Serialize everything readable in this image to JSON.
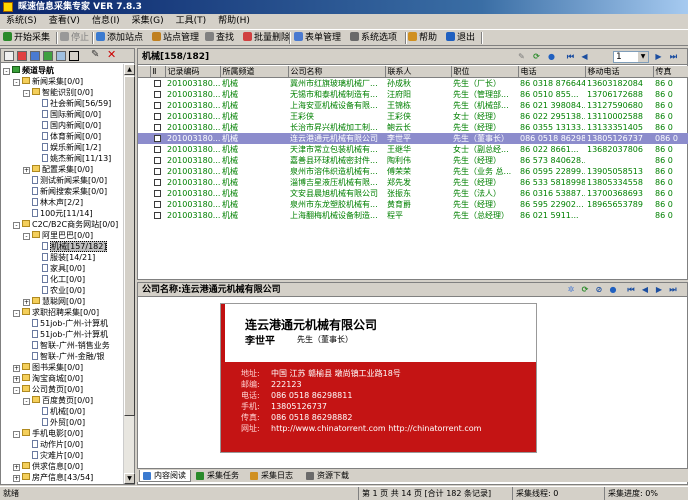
{
  "window": {
    "title": "睬速信息采集专家 VER 7.8.3"
  },
  "menu": [
    "系统(S)",
    "查看(V)",
    "信息(I)",
    "采集(G)",
    "工具(T)",
    "帮助(H)"
  ],
  "toolbar": [
    {
      "label": "开始采集",
      "enabled": true
    },
    {
      "label": "停止",
      "enabled": false
    },
    {
      "label": "添加站点",
      "enabled": true
    },
    {
      "label": "站点管理",
      "enabled": true
    },
    {
      "label": "查找",
      "enabled": true
    },
    {
      "label": "批量删除",
      "enabled": true
    },
    {
      "label": "表单管理",
      "enabled": true
    },
    {
      "label": "系统选项",
      "enabled": true
    },
    {
      "label": "帮助",
      "enabled": true
    },
    {
      "label": "退出",
      "enabled": true
    }
  ],
  "tree": [
    {
      "label": "频道导航",
      "level": 0,
      "type": "root",
      "exp": "-"
    },
    {
      "label": "新闻采集[0/0]",
      "level": 1,
      "type": "folder",
      "exp": "-"
    },
    {
      "label": "智能识别[0/0]",
      "level": 2,
      "type": "folder",
      "exp": "-"
    },
    {
      "label": "社会新闻[56/59]",
      "level": 3,
      "type": "doc"
    },
    {
      "label": "国际新闻[0/0]",
      "level": 3,
      "type": "doc"
    },
    {
      "label": "国内新闻[0/0]",
      "level": 3,
      "type": "doc"
    },
    {
      "label": "体育新闻[0/0]",
      "level": 3,
      "type": "doc"
    },
    {
      "label": "娱乐新闻[1/2]",
      "level": 3,
      "type": "doc"
    },
    {
      "label": "姚杰新闻[11/13]",
      "level": 3,
      "type": "doc"
    },
    {
      "label": "配置采集[0/0]",
      "level": 2,
      "type": "folder",
      "exp": "+"
    },
    {
      "label": "测试新闻采集[0/0]",
      "level": 2,
      "type": "doc"
    },
    {
      "label": "新闻搜索采集[0/0]",
      "level": 2,
      "type": "doc"
    },
    {
      "label": "林木声[2/2]",
      "level": 2,
      "type": "doc"
    },
    {
      "label": "100元[11/14]",
      "level": 2,
      "type": "doc"
    },
    {
      "label": "C2C/B2C商务网站[0/0]",
      "level": 1,
      "type": "folder",
      "exp": "-"
    },
    {
      "label": "阿里巴巴[0/0]",
      "level": 2,
      "type": "folder",
      "exp": "-"
    },
    {
      "label": "机械[157/182]",
      "level": 3,
      "type": "doc",
      "selected": true
    },
    {
      "label": "服装[14/21]",
      "level": 3,
      "type": "doc"
    },
    {
      "label": "家具[0/0]",
      "level": 3,
      "type": "doc"
    },
    {
      "label": "化工[0/0]",
      "level": 3,
      "type": "doc"
    },
    {
      "label": "农业[0/0]",
      "level": 3,
      "type": "doc"
    },
    {
      "label": "慧聪网[0/0]",
      "level": 2,
      "type": "folder",
      "exp": "+"
    },
    {
      "label": "求职招聘采集[0/0]",
      "level": 1,
      "type": "folder",
      "exp": "-"
    },
    {
      "label": "51job-广州-计算机",
      "level": 2,
      "type": "doc"
    },
    {
      "label": "51job-广州-计算机",
      "level": 2,
      "type": "doc"
    },
    {
      "label": "智联-广州-销售业务",
      "level": 2,
      "type": "doc"
    },
    {
      "label": "智联-广州-金融/银",
      "level": 2,
      "type": "doc"
    },
    {
      "label": "图书采集[0/0]",
      "level": 1,
      "type": "folder",
      "exp": "+"
    },
    {
      "label": "淘宝商城[0/0]",
      "level": 1,
      "type": "folder",
      "exp": "+"
    },
    {
      "label": "公司黄页[0/0]",
      "level": 1,
      "type": "folder",
      "exp": "-"
    },
    {
      "label": "百度黄页[0/0]",
      "level": 2,
      "type": "folder",
      "exp": "-"
    },
    {
      "label": "机械[0/0]",
      "level": 3,
      "type": "doc"
    },
    {
      "label": "外贸[0/0]",
      "level": 3,
      "type": "doc"
    },
    {
      "label": "手机电影[0/0]",
      "level": 1,
      "type": "folder",
      "exp": "-"
    },
    {
      "label": "动作片[0/0]",
      "level": 2,
      "type": "doc"
    },
    {
      "label": "灾难片[0/0]",
      "level": 2,
      "type": "doc"
    },
    {
      "label": "供求信息[0/0]",
      "level": 1,
      "type": "folder",
      "exp": "+"
    },
    {
      "label": "房产信息[43/54]",
      "level": 1,
      "type": "folder",
      "exp": "+"
    }
  ],
  "list": {
    "title": "机械[158/182]",
    "page": "1",
    "columns": [
      "",
      "记录编码",
      "所属频道",
      "公司名称",
      "联系人",
      "职位",
      "电话",
      "移动电话",
      "传真"
    ],
    "rows": [
      [
        "201003180...",
        "机械",
        "冀州市红旗玻璃机械厂...",
        "孙成秋",
        "先生（厂长）",
        "86 0318 876644...",
        "13603182084",
        "86 0"
      ],
      [
        "201003180...",
        "机械",
        "无锡市和泰机械制造有...",
        "汪府阳",
        "先生（管理部...",
        "86 0510 855...",
        "13706172688",
        "86 0"
      ],
      [
        "201003180...",
        "机械",
        "上海安亚机械设备有限...",
        "王锦栋",
        "先生（机械部...",
        "86 021 398084...",
        "13127590680",
        "86 0"
      ],
      [
        "201003180...",
        "机械",
        "王彩侠",
        "王彩侠",
        "女士（经理）",
        "86 022 295138...",
        "13110002588",
        "86 0"
      ],
      [
        "201003180...",
        "机械",
        "长治市昇兴机械加工制...",
        "鲍云长",
        "先生（经理）",
        "86 0355 13133...",
        "13133351405",
        "86 0"
      ],
      [
        "201003180...",
        "机械",
        "连云港通元机械有限公司",
        "李世平",
        "先生（董事长）",
        "086 0518 86298...",
        "13805126737",
        "086 0"
      ],
      [
        "201003180...",
        "机械",
        "天津市常立包装机械有...",
        "王继华",
        "女士（副总经...",
        "86 022 8661...",
        "13682037806",
        "86 0"
      ],
      [
        "201003180...",
        "机械",
        "嘉善县环球机械密封件...",
        "陶利伟",
        "先生（经理）",
        "86 573 840628...",
        "",
        "86 0"
      ],
      [
        "201003180...",
        "机械",
        "泉州市溶伟织造机械有...",
        "傅荣荣",
        "先生（业务 总...",
        "86 0595 22899...",
        "13905058513",
        "86 0"
      ],
      [
        "201003180...",
        "机械",
        "淄博吉星液压机械有限...",
        "郑先发",
        "先生（经理）",
        "86 533 5818998",
        "13805334558",
        "86 0"
      ],
      [
        "201003180...",
        "机械",
        "文安县晨旭机械有限公司",
        "张振东",
        "先生（法人）",
        "86 0316 53887...",
        "13700368693",
        "86 0"
      ],
      [
        "201003180...",
        "机械",
        "泉州市东龙塑胶机械有...",
        "黄育爵",
        "先生（经理）",
        "86 595 22902...",
        "18965653789",
        "86 0"
      ],
      [
        "201003180...",
        "机械",
        "上海翻梅机械设备制造...",
        "程平",
        "先生（总经理）",
        "86 021 5911...",
        "",
        "86 0"
      ]
    ],
    "selected_index": 5
  },
  "detail": {
    "header": "公司名称:连云港通元机械有限公司",
    "card": {
      "company": "连云港通元机械有限公司",
      "person": "李世平",
      "role": "先生（董事长）",
      "rows": [
        {
          "k": "地址:",
          "v": "中国 江苏 赣榆县 墩尚镇工业路18号"
        },
        {
          "k": "邮编:",
          "v": "222123"
        },
        {
          "k": "电话:",
          "v": "086 0518 86298811"
        },
        {
          "k": "手机:",
          "v": "13805126737"
        },
        {
          "k": "传真:",
          "v": "086 0518 86298882"
        },
        {
          "k": "网址:",
          "v": "http://www.chinatorrent.com http://chinatorrent.com"
        }
      ]
    }
  },
  "bottom_tabs": [
    "内容阅读",
    "采集任务",
    "采集日志",
    "资源下载"
  ],
  "status": {
    "left": "就绪",
    "page": "第 1 页 共 14 页 [合计 182 条记录]",
    "thread": "采集线程: 0",
    "progress": "采集进度: 0%"
  }
}
